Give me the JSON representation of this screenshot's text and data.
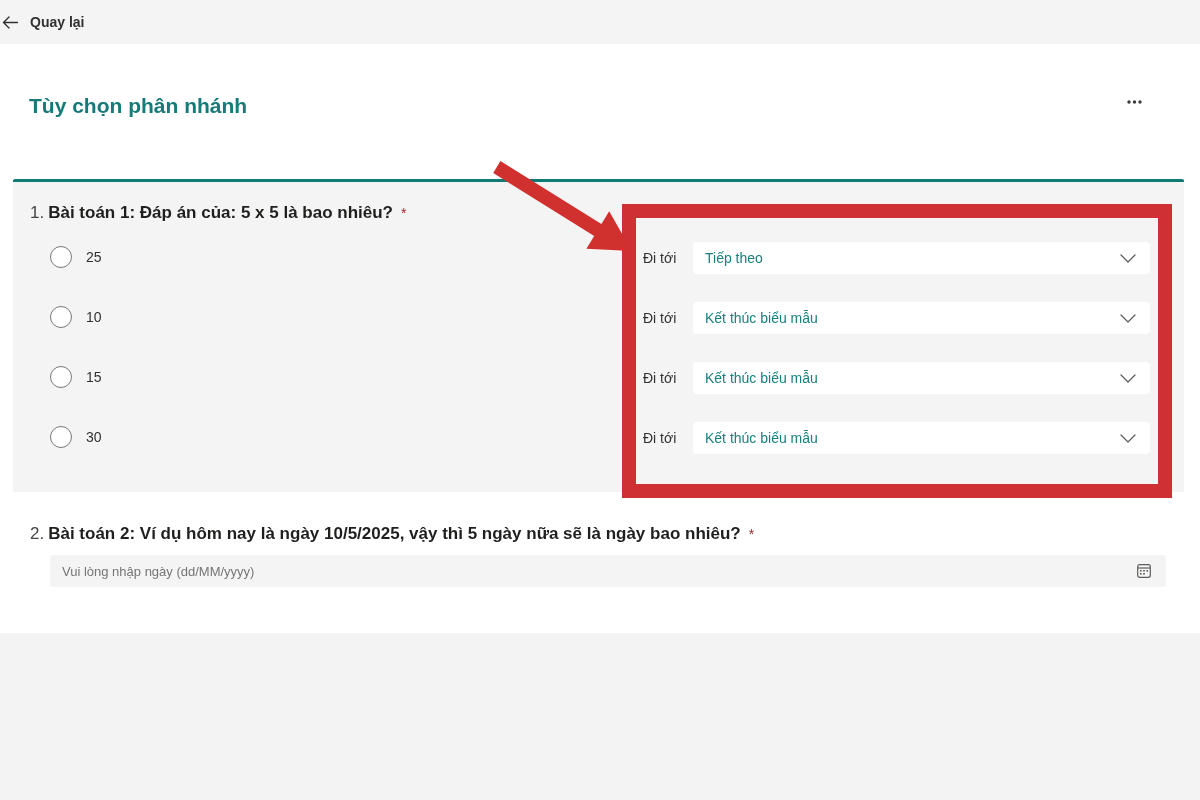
{
  "back_button": {
    "label": "Quay lại"
  },
  "header": {
    "title": "Tùy chọn phân nhánh"
  },
  "questions": [
    {
      "kind": "choice",
      "selected": true,
      "annotated": true,
      "number": "1.",
      "title": "Bài toán 1: Đáp án của: 5 x 5 là bao nhiêu?",
      "required_mark": "*",
      "options": [
        {
          "label": "25",
          "selected": false,
          "branch_label": "Đi tới",
          "branch_target": "Tiếp theo"
        },
        {
          "label": "10",
          "selected": false,
          "branch_label": "Đi tới",
          "branch_target": "Kết thúc biểu mẫu"
        },
        {
          "label": "15",
          "selected": false,
          "branch_label": "Đi tới",
          "branch_target": "Kết thúc biểu mẫu"
        },
        {
          "label": "30",
          "selected": false,
          "branch_label": "Đi tới",
          "branch_target": "Kết thúc biểu mẫu"
        }
      ]
    },
    {
      "kind": "date",
      "selected": false,
      "number": "2.",
      "title": "Bài toán 2: Ví dụ hôm nay là ngày 10/5/2025, vậy thì 5 ngày nữa sẽ là ngày bao nhiêu?",
      "required_mark": "*",
      "placeholder": "Vui lòng nhập ngày (dd/MM/yyyy)"
    }
  ]
}
